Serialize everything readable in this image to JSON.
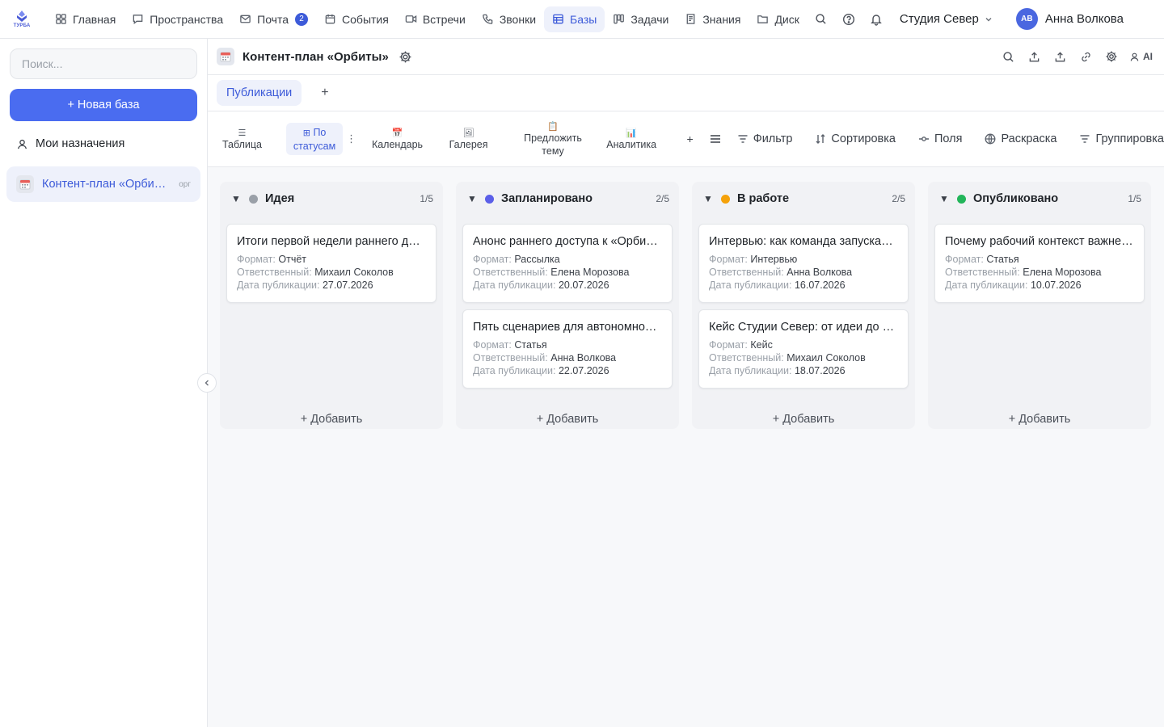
{
  "brand": {
    "logo_text": "ТУРБА",
    "accent": "#3d5bd9",
    "primary_button": "#4a6cf0"
  },
  "topnav": {
    "items": [
      {
        "label": "Главная",
        "icon": "grid-icon"
      },
      {
        "label": "Пространства",
        "icon": "chat-icon"
      },
      {
        "label": "Почта",
        "icon": "mail-icon",
        "badge": "2"
      },
      {
        "label": "События",
        "icon": "calendar-icon"
      },
      {
        "label": "Встречи",
        "icon": "video-icon"
      },
      {
        "label": "Звонки",
        "icon": "phone-icon"
      },
      {
        "label": "Базы",
        "icon": "table-icon",
        "active": true
      },
      {
        "label": "Задачи",
        "icon": "kanban-icon"
      },
      {
        "label": "Знания",
        "icon": "book-icon"
      },
      {
        "label": "Диск",
        "icon": "folder-icon"
      }
    ],
    "workspace": "Студия Север",
    "user": {
      "initials": "АВ",
      "name": "Анна Волкова"
    }
  },
  "sidebar": {
    "search_placeholder": "Поиск...",
    "new_base_label": "+ Новая база",
    "my_assignments": "Мои назначения",
    "bases": [
      {
        "label": "Контент-план «Орбиты»",
        "tag": "орг"
      }
    ]
  },
  "header": {
    "title": "Контент-план «Орбиты»",
    "ai_label": "AI"
  },
  "tabs": {
    "items": [
      "Публикации"
    ],
    "add": "+"
  },
  "views": {
    "items": [
      {
        "icon": "☰",
        "label": "Таблица"
      },
      {
        "icon": "⊞",
        "label": "По статусам",
        "active": true
      },
      {
        "icon": "📅",
        "label": "Календарь"
      },
      {
        "icon": "🖼",
        "label": "Галерея"
      },
      {
        "icon": "📋",
        "label": "Предложить тему"
      },
      {
        "icon": "📊",
        "label": "Аналитика"
      }
    ],
    "add": "+",
    "tools": {
      "filter": "Фильтр",
      "sort": "Сортировка",
      "fields": "Поля",
      "coloring": "Раскраска",
      "group": "Группировка"
    }
  },
  "board": {
    "add_label": "+ Добавить",
    "field_labels": {
      "format": "Формат:",
      "owner": "Ответственный:",
      "date": "Дата публикации:"
    },
    "columns": [
      {
        "title": "Идея",
        "count": "1/5",
        "color": "#9aa0a8",
        "cards": [
          {
            "title": "Итоги первой недели раннего доступа",
            "format": "Отчёт",
            "owner": "Михаил Соколов",
            "date": "27.07.2026"
          }
        ]
      },
      {
        "title": "Запланировано",
        "count": "2/5",
        "color": "#5b5fe8",
        "cards": [
          {
            "title": "Анонс раннего доступа к «Орбите»",
            "format": "Рассылка",
            "owner": "Елена Морозова",
            "date": "20.07.2026"
          },
          {
            "title": "Пять сценариев для автономной работы",
            "format": "Статья",
            "owner": "Анна Волкова",
            "date": "22.07.2026"
          }
        ]
      },
      {
        "title": "В работе",
        "count": "2/5",
        "color": "#f5a20a",
        "cards": [
          {
            "title": "Интервью: как команда запускала «Орбиту»",
            "format": "Интервью",
            "owner": "Анна Волкова",
            "date": "16.07.2026"
          },
          {
            "title": "Кейс Студии Север: от идеи до релиза",
            "format": "Кейс",
            "owner": "Михаил Соколов",
            "date": "18.07.2026"
          }
        ]
      },
      {
        "title": "Опубликовано",
        "count": "1/5",
        "color": "#22b55a",
        "cards": [
          {
            "title": "Почему рабочий контекст важнее чата",
            "format": "Статья",
            "owner": "Елена Морозова",
            "date": "10.07.2026"
          }
        ]
      }
    ]
  }
}
